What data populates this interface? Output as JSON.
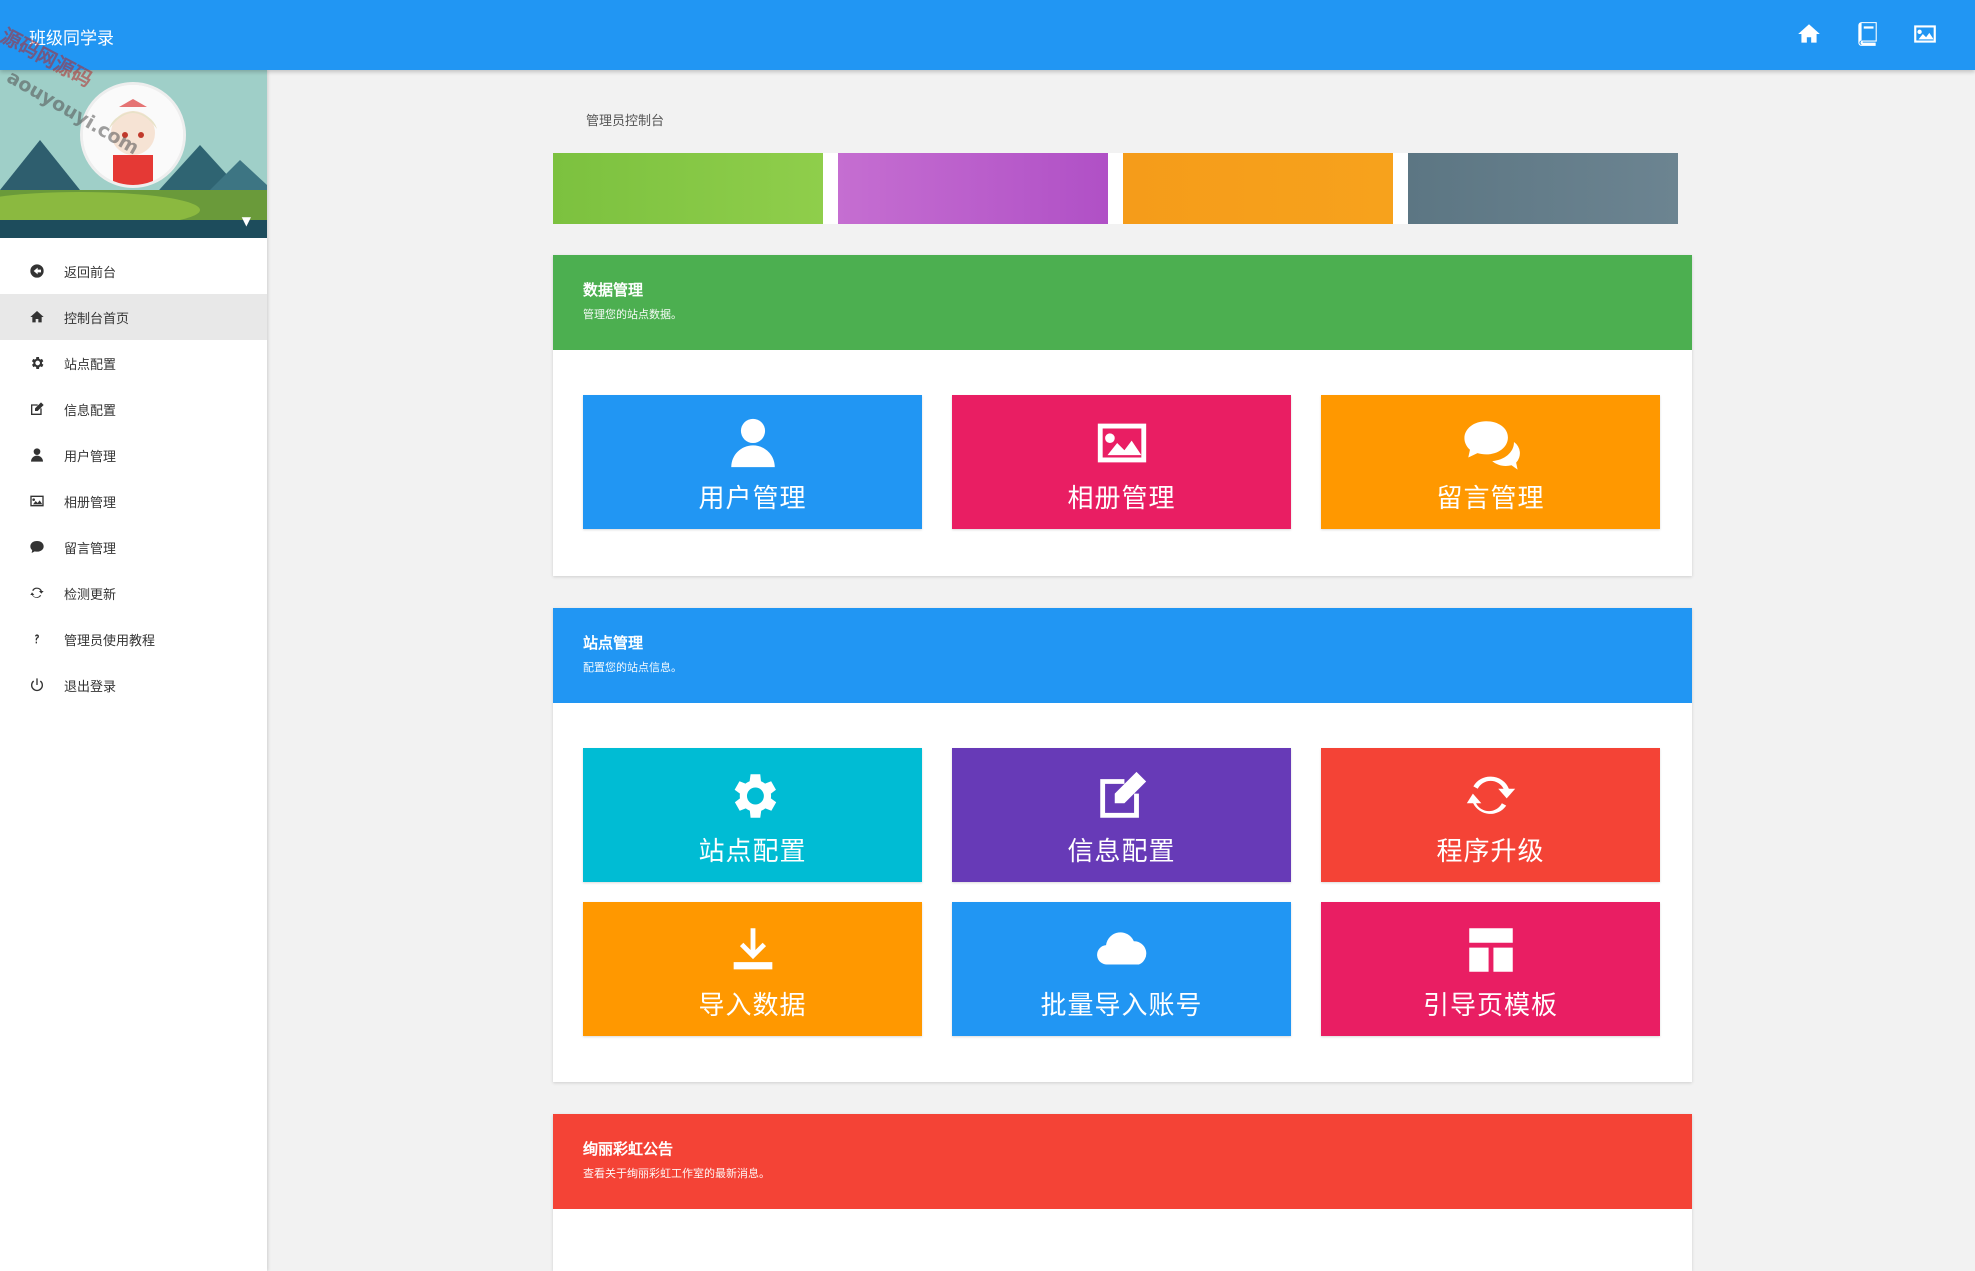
{
  "app": {
    "title": "班级同学录"
  },
  "topbar": {
    "actions": [
      {
        "name": "home-icon"
      },
      {
        "name": "book-icon"
      },
      {
        "name": "image-icon"
      }
    ]
  },
  "watermark": {
    "line1": "源码网源码",
    "line2": "aouyouyi.com"
  },
  "breadcrumb": "管理员控制台",
  "sidebar": {
    "items": [
      {
        "label": "返回前台",
        "icon": "arrow-circle-left-icon"
      },
      {
        "label": "控制台首页",
        "icon": "home-icon",
        "active": true
      },
      {
        "label": "站点配置",
        "icon": "gear-icon"
      },
      {
        "label": "信息配置",
        "icon": "edit-icon"
      },
      {
        "label": "用户管理",
        "icon": "user-icon"
      },
      {
        "label": "相册管理",
        "icon": "image-icon"
      },
      {
        "label": "留言管理",
        "icon": "comment-icon"
      },
      {
        "label": "检测更新",
        "icon": "refresh-icon"
      },
      {
        "label": "管理员使用教程",
        "icon": "question-icon"
      },
      {
        "label": "退出登录",
        "icon": "power-icon"
      }
    ]
  },
  "colors": {
    "primary": "#2196f3",
    "green": "#4caf50",
    "pink": "#e91e63",
    "orange": "#ff9800",
    "cyan": "#00bcd4",
    "purple": "#673ab7",
    "red": "#f44336"
  },
  "panels": {
    "data": {
      "title": "数据管理",
      "subtitle": "管理您的站点数据。",
      "tiles": [
        {
          "label": "用户管理",
          "icon": "user-icon"
        },
        {
          "label": "相册管理",
          "icon": "image-icon"
        },
        {
          "label": "留言管理",
          "icon": "comments-icon"
        }
      ]
    },
    "site": {
      "title": "站点管理",
      "subtitle": "配置您的站点信息。",
      "tiles": [
        {
          "label": "站点配置",
          "icon": "gear-icon"
        },
        {
          "label": "信息配置",
          "icon": "edit-icon"
        },
        {
          "label": "程序升级",
          "icon": "refresh-icon"
        },
        {
          "label": "导入数据",
          "icon": "import-icon"
        },
        {
          "label": "批量导入账号",
          "icon": "cloud-icon"
        },
        {
          "label": "引导页模板",
          "icon": "template-icon"
        }
      ]
    },
    "notice": {
      "title": "绚丽彩虹公告",
      "subtitle": "查看关于绚丽彩虹工作室的最新消息。"
    }
  }
}
